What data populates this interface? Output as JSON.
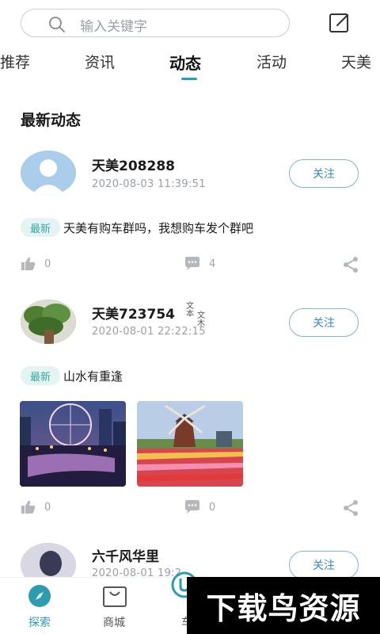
{
  "search": {
    "placeholder": "输入关键字"
  },
  "tabs": [
    {
      "label": "推荐"
    },
    {
      "label": "资讯"
    },
    {
      "label": "动态",
      "active": true
    },
    {
      "label": "活动"
    },
    {
      "label": "天美"
    }
  ],
  "section_title": "最新动态",
  "posts": [
    {
      "username": "天美208288",
      "time": "2020-08-03 11:39:51",
      "follow_label": "关注",
      "badge": "最新",
      "text": "天美有购车群吗，我想购车发个群吧",
      "likes": "0",
      "comments": "4"
    },
    {
      "username": "天美723754",
      "time": "2020-08-01 22:22:15",
      "follow_label": "关注",
      "badge": "最新",
      "text": "山水有重逢",
      "likes": "0",
      "comments": "0",
      "caption_a": "文\n本",
      "caption_b": "文\n木"
    },
    {
      "username": "六千风华里",
      "time": "2020-08-01 19:2",
      "follow_label": "关注"
    }
  ],
  "bottom_nav": [
    {
      "label": "探索",
      "active": true
    },
    {
      "label": "商城"
    },
    {
      "label": "车"
    }
  ],
  "watermark": "下载鸟资源",
  "colors": {
    "accent": "#2d9cb0",
    "follow_border": "#7fb4d6",
    "badge_bg": "#e3f4f3"
  }
}
